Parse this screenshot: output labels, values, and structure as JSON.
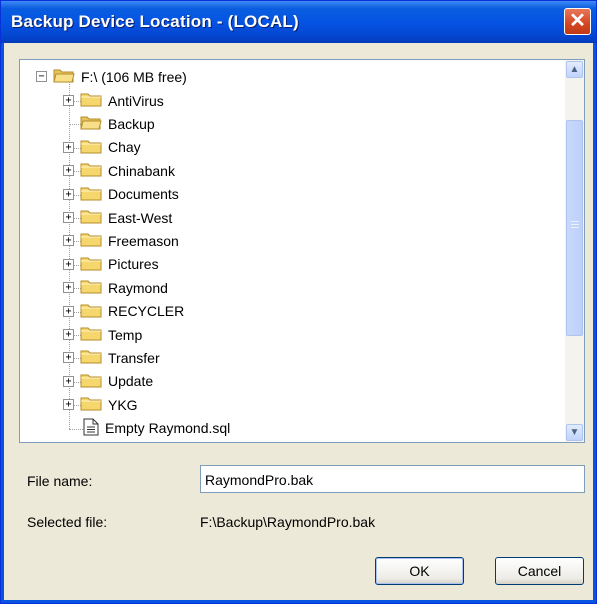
{
  "window": {
    "title": "Backup Device Location - (LOCAL)",
    "close_glyph": "✕"
  },
  "tree": {
    "root": {
      "label": "F:\\ (106 MB free)",
      "expander": "−",
      "icon": "folder-open-icon"
    },
    "items": [
      {
        "label": "AntiVirus",
        "type": "folder",
        "expander": "+"
      },
      {
        "label": "Backup",
        "type": "folder-open",
        "expander": ""
      },
      {
        "label": "Chay",
        "type": "folder",
        "expander": "+"
      },
      {
        "label": "Chinabank",
        "type": "folder",
        "expander": "+"
      },
      {
        "label": "Documents",
        "type": "folder",
        "expander": "+"
      },
      {
        "label": "East-West",
        "type": "folder",
        "expander": "+"
      },
      {
        "label": "Freemason",
        "type": "folder",
        "expander": "+"
      },
      {
        "label": "Pictures",
        "type": "folder",
        "expander": "+"
      },
      {
        "label": "Raymond",
        "type": "folder",
        "expander": "+"
      },
      {
        "label": "RECYCLER",
        "type": "folder",
        "expander": "+"
      },
      {
        "label": "Temp",
        "type": "folder",
        "expander": "+"
      },
      {
        "label": "Transfer",
        "type": "folder",
        "expander": "+"
      },
      {
        "label": "Update",
        "type": "folder",
        "expander": "+"
      },
      {
        "label": "YKG",
        "type": "folder",
        "expander": "+"
      },
      {
        "label": "Empty Raymond.sql",
        "type": "file",
        "expander": ""
      }
    ],
    "scroll_up_glyph": "▲",
    "scroll_down_glyph": "▼"
  },
  "form": {
    "file_name_label": "File name:",
    "file_name_value": "RaymondPro.bak",
    "selected_file_label": "Selected file:",
    "selected_file_value": "F:\\Backup\\RaymondPro.bak"
  },
  "buttons": {
    "ok": "OK",
    "cancel": "Cancel"
  },
  "colors": {
    "titlebar": "#0554e3",
    "close_button": "#d44521",
    "dialog_bg": "#ece9d8",
    "folder": "#f5d76e"
  }
}
